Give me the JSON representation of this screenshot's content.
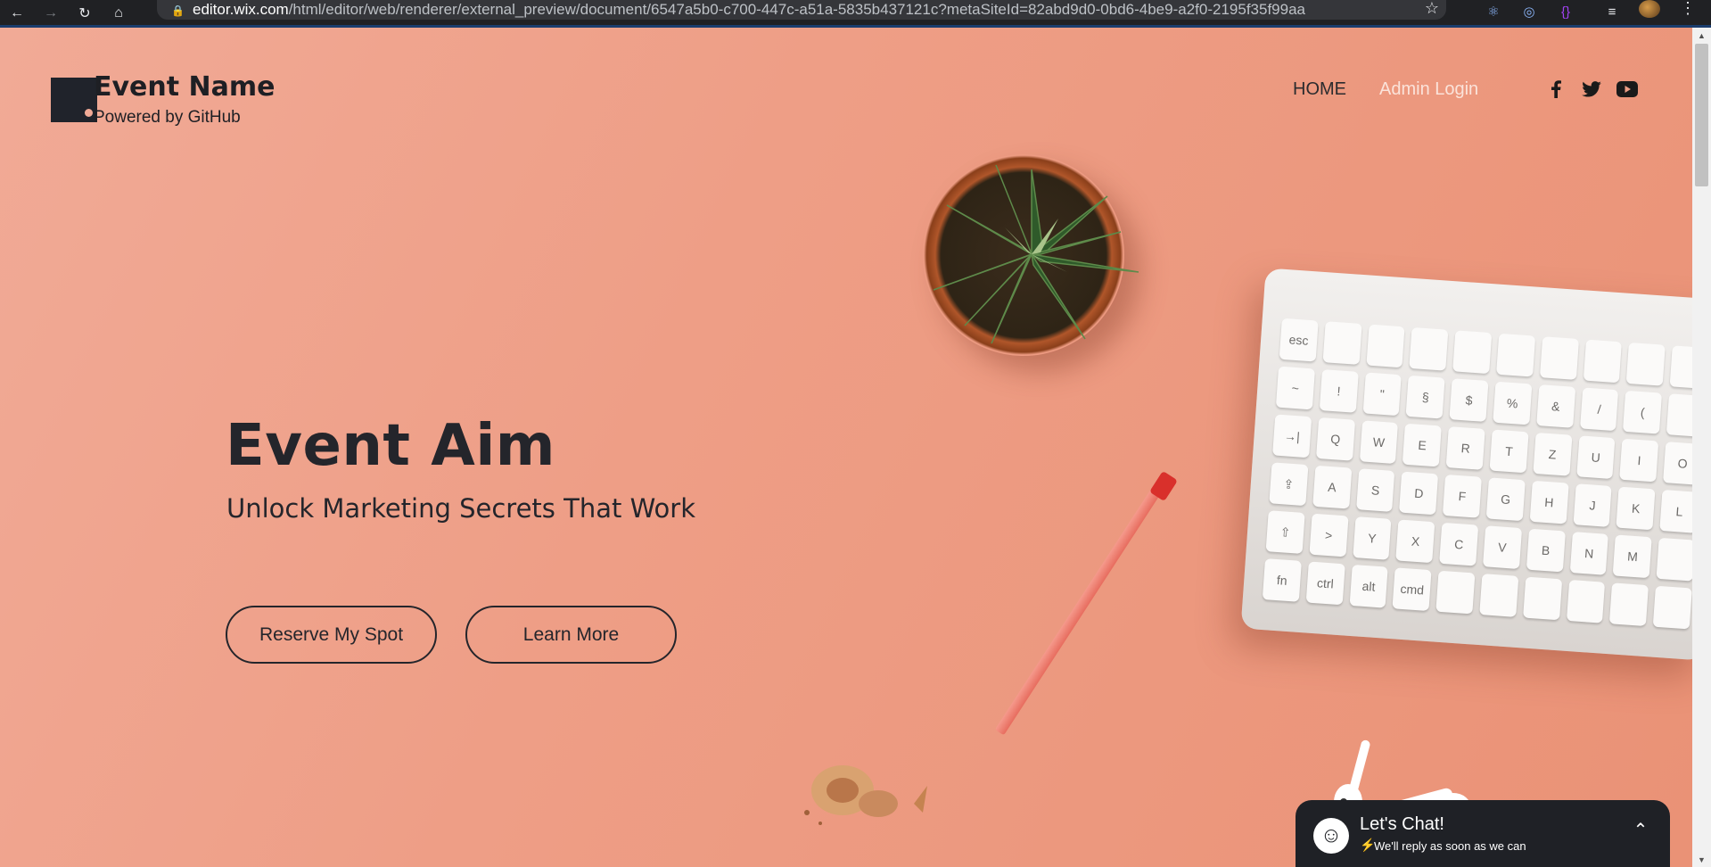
{
  "browser": {
    "url_host": "editor.wix.com",
    "url_path": "/html/editor/web/renderer/external_preview/document/6547a5b0-c700-447c-a51a-5835b437121c?metaSiteId=82abd9d0-0bd6-4be9-a2f0-2195f35f99aa",
    "back_icon": "←",
    "forward_icon": "→",
    "reload_icon": "↻",
    "home_icon": "⌂",
    "lock_icon": "🔒",
    "star_icon": "☆",
    "menu_icon": "⋮"
  },
  "header": {
    "site_name": "Event Name",
    "site_sub": "Powered by GitHub",
    "nav": [
      {
        "label": "HOME"
      },
      {
        "label": "Admin Login"
      }
    ],
    "social": [
      "facebook-icon",
      "twitter-icon",
      "youtube-icon"
    ]
  },
  "hero": {
    "title": "Event Aim",
    "subtitle": "Unlock Marketing Secrets That Work",
    "buttons": [
      {
        "label": "Reserve My Spot"
      },
      {
        "label": "Learn More"
      }
    ]
  },
  "chat": {
    "title": "Let's Chat!",
    "subtitle": "We'll reply as soon as we can",
    "bolt_icon": "⚡",
    "face_icon": "☺",
    "toggle_icon": "⌃"
  },
  "keyboard_keys": [
    "esc",
    "",
    "",
    "",
    "",
    "",
    "",
    "",
    "",
    "",
    "~",
    "!",
    "\"",
    "§",
    "$",
    "%",
    "&",
    "/",
    "(",
    "",
    "→|",
    "Q",
    "W",
    "E",
    "R",
    "T",
    "Z",
    "U",
    "I",
    "O",
    "⇪",
    "A",
    "S",
    "D",
    "F",
    "G",
    "H",
    "J",
    "K",
    "L",
    "⇧",
    ">",
    "Y",
    "X",
    "C",
    "V",
    "B",
    "N",
    "M",
    "",
    "fn",
    "ctrl",
    "alt",
    "cmd",
    "",
    "",
    "",
    "",
    "",
    ""
  ],
  "colors": {
    "background": "#ee9e86",
    "text_dark": "#24252b",
    "nav_active": "#2b2b2e",
    "nav_light": "#fbe3da",
    "chat_bg": "#1f2126"
  }
}
